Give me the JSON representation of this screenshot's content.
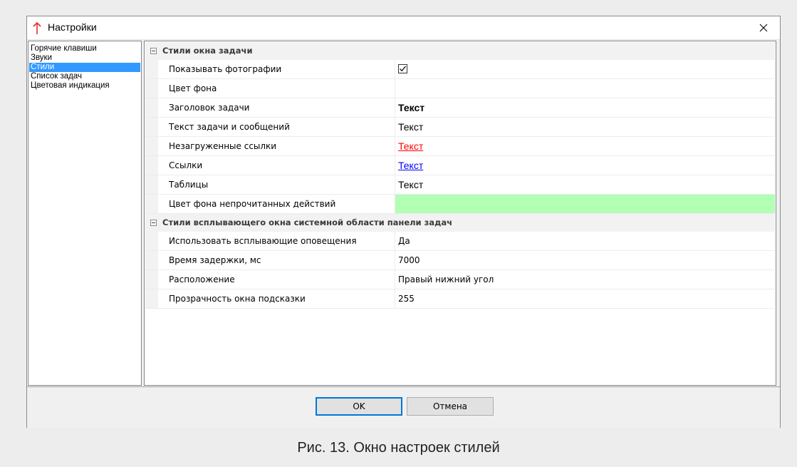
{
  "window": {
    "title": "Настройки",
    "close_symbol": "✕",
    "accent_color": "#e0302a"
  },
  "nav": {
    "items": [
      {
        "label": "Горячие клавиши",
        "selected": false
      },
      {
        "label": "Звуки",
        "selected": false
      },
      {
        "label": "Стили",
        "selected": true
      },
      {
        "label": "Список задач",
        "selected": false
      },
      {
        "label": "Цветовая индикация",
        "selected": false
      }
    ]
  },
  "grid": {
    "group1": {
      "label": "Стили окна задачи",
      "rows": [
        {
          "name": "Показывать фотографии",
          "value": "",
          "checked": true
        },
        {
          "name": "Цвет фона",
          "value": ""
        },
        {
          "name": "Заголовок задачи",
          "value": "Текст"
        },
        {
          "name": "Текст задачи и сообщений",
          "value": "Текст"
        },
        {
          "name": "Незагруженные ссылки",
          "value": "Текст"
        },
        {
          "name": "Ссылки",
          "value": "Текст"
        },
        {
          "name": "Таблицы",
          "value": "Текст"
        },
        {
          "name": "Цвет фона непрочитанных действий",
          "value": "",
          "swatch": "#b3ffb3"
        }
      ]
    },
    "group2": {
      "label": "Стили всплывающего окна системной области панели задач",
      "rows": [
        {
          "name": "Использовать всплывающие оповещения",
          "value": "Да"
        },
        {
          "name": "Время задержки, мс",
          "value": "7000"
        },
        {
          "name": "Расположение",
          "value": "Правый нижний угол"
        },
        {
          "name": "Прозрачность окна подсказки",
          "value": "255"
        }
      ]
    }
  },
  "buttons": {
    "ok": "OK",
    "cancel": "Отмена"
  },
  "caption": "Рис. 13. Окно настроек стилей"
}
